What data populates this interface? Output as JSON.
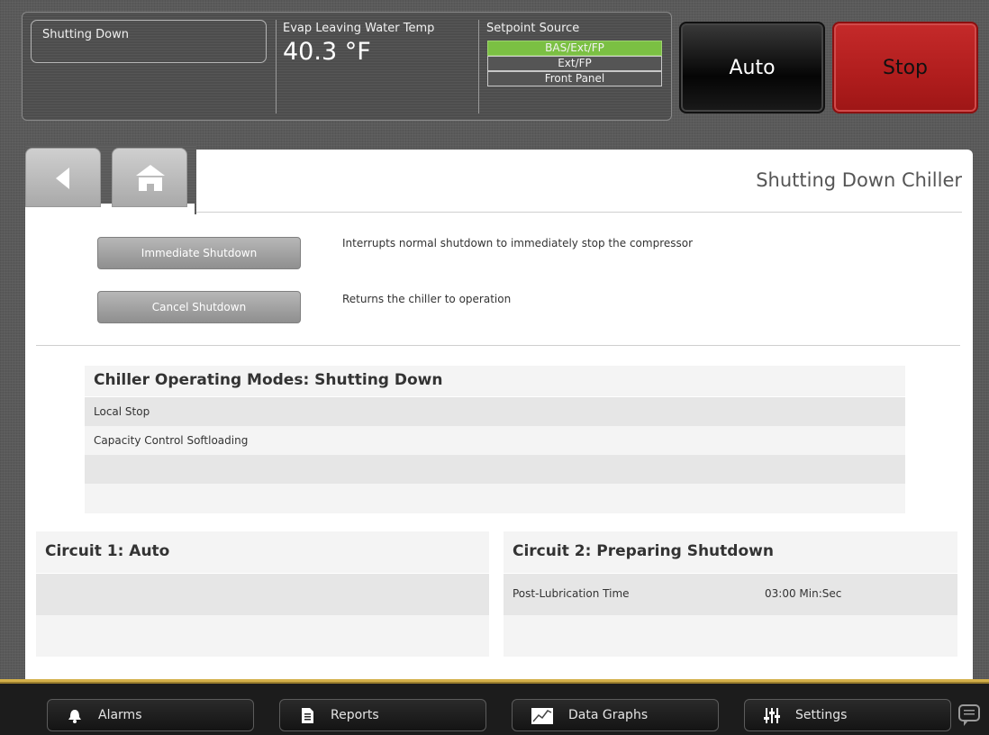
{
  "header": {
    "state_text": "Shutting Down",
    "evap_label": "Evap Leaving Water Temp",
    "evap_value": "40.3 °F",
    "setpoint_label": "Setpoint Source",
    "setpoint_options": [
      "BAS/Ext/FP",
      "Ext/FP",
      "Front Panel"
    ],
    "setpoint_active": "BAS/Ext/FP",
    "auto_label": "Auto",
    "stop_label": "Stop"
  },
  "nav": {
    "back_icon": "back-arrow-icon",
    "home_icon": "home-icon"
  },
  "page": {
    "title": "Shutting Down Chiller",
    "actions": [
      {
        "label": "Immediate Shutdown",
        "description": "Interrupts normal shutdown to immediately stop the compressor"
      },
      {
        "label": "Cancel Shutdown",
        "description": "Returns the chiller to operation"
      }
    ],
    "modes_title": "Chiller Operating Modes: Shutting Down",
    "modes": [
      "Local Stop",
      "Capacity Control Softloading",
      "",
      ""
    ],
    "circuit1": {
      "title": "Circuit 1: Auto",
      "rows": []
    },
    "circuit2": {
      "title": "Circuit 2: Preparing Shutdown",
      "rows": [
        {
          "label": "Post-Lubrication Time",
          "value": "03:00 Min:Sec"
        }
      ]
    }
  },
  "bottom_nav": {
    "alarms": "Alarms",
    "reports": "Reports",
    "data_graphs": "Data Graphs",
    "settings": "Settings"
  },
  "colors": {
    "active_setpoint": "#7bc043",
    "stop": "#b01d1d",
    "accent_bar": "#d4b04a"
  }
}
